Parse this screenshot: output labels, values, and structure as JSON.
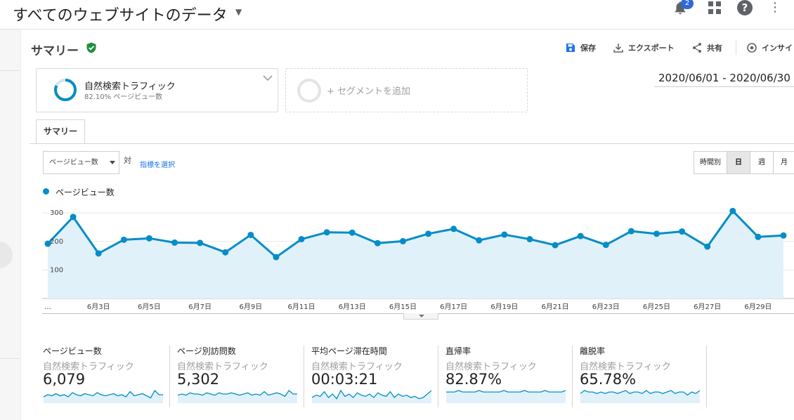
{
  "header": {
    "view_title": "すべてのウェブサイトのデータ",
    "notification_count": "2"
  },
  "report": {
    "title": "サマリー",
    "actions": {
      "save": "保存",
      "export": "エクスポート",
      "share": "共有",
      "insights": "インサイ"
    }
  },
  "segments": {
    "active_name": "自然検索トラフィック",
    "active_sub": "82.10% ページビュー数",
    "active_percent": 82.1,
    "add_label": "+ セグメントを追加"
  },
  "date_range": "2020/06/01 - 2020/06/30",
  "tabs": {
    "summary": "サマリー"
  },
  "controls": {
    "metric_selected": "ページビュー数",
    "versus": "対",
    "select_metric": "指標を選択",
    "granularity": [
      "時間別",
      "日",
      "週",
      "月"
    ],
    "granularity_selected": "日"
  },
  "colors": {
    "series": "#058dc7",
    "fill": "#e1f1fa",
    "accent": "#1a73e8",
    "verified": "#1e8e3e"
  },
  "chart_data": {
    "type": "area",
    "series": [
      {
        "name": "ページビュー数",
        "values": [
          192,
          286,
          158,
          206,
          211,
          196,
          195,
          162,
          223,
          145,
          208,
          232,
          231,
          194,
          201,
          227,
          244,
          204,
          224,
          208,
          187,
          219,
          188,
          236,
          227,
          235,
          182,
          307,
          216,
          221
        ]
      }
    ],
    "x_tick_labels": [
      "…",
      "6月3日",
      "6月5日",
      "6月7日",
      "6月9日",
      "6月11日",
      "6月13日",
      "6月15日",
      "6月17日",
      "6月19日",
      "6月21日",
      "6月23日",
      "6月25日",
      "6月27日",
      "6月29日"
    ],
    "y_ticks": [
      100,
      200,
      300
    ],
    "ylim": [
      0,
      330
    ],
    "grid": true
  },
  "scorecards": [
    {
      "name": "ページビュー数",
      "segment": "自然検索トラフィック",
      "value": "6,079",
      "spark": [
        4,
        6,
        5,
        7,
        5,
        6,
        4,
        8,
        6,
        5,
        7,
        6,
        5,
        8,
        6,
        5,
        6,
        7,
        5,
        6,
        4,
        9,
        5,
        6,
        7,
        5,
        3,
        10,
        6,
        6
      ]
    },
    {
      "name": "ページ別訪問数",
      "segment": "自然検索トラフィック",
      "value": "5,302",
      "spark": [
        5,
        6,
        5,
        7,
        6,
        6,
        5,
        7,
        6,
        5,
        7,
        6,
        6,
        7,
        6,
        5,
        6,
        7,
        5,
        6,
        5,
        8,
        5,
        6,
        7,
        6,
        4,
        9,
        6,
        6
      ]
    },
    {
      "name": "平均ページ滞在時間",
      "segment": "自然検索トラフィック",
      "value": "00:03:21",
      "spark": [
        3,
        5,
        4,
        8,
        3,
        6,
        2,
        9,
        4,
        6,
        3,
        7,
        5,
        4,
        6,
        3,
        7,
        5,
        4,
        8,
        3,
        6,
        4,
        5,
        3,
        4,
        2,
        3,
        6,
        9
      ]
    },
    {
      "name": "直帰率",
      "segment": "自然検索トラフィック",
      "value": "82.87%",
      "spark": [
        6,
        6,
        6,
        7,
        6,
        6,
        6,
        6,
        7,
        6,
        6,
        6,
        6,
        6,
        7,
        6,
        6,
        6,
        6,
        7,
        6,
        6,
        6,
        6,
        7,
        6,
        6,
        6,
        6,
        7
      ]
    },
    {
      "name": "離脱率",
      "segment": "自然検索トラフィック",
      "value": "65.78%",
      "spark": [
        5,
        7,
        6,
        6,
        5,
        6,
        5,
        6,
        6,
        5,
        6,
        7,
        5,
        6,
        6,
        5,
        7,
        5,
        6,
        6,
        5,
        6,
        7,
        5,
        6,
        6,
        4,
        6,
        5,
        7
      ]
    }
  ]
}
